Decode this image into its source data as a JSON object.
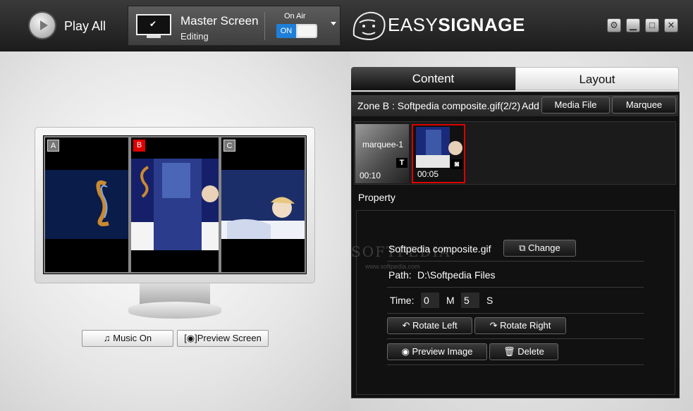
{
  "toolbar": {
    "play_all": "Play All",
    "screen_name": "Master Screen",
    "screen_status": "Editing",
    "on_air_label": "On Air",
    "on_air_toggle": "ON"
  },
  "logo": {
    "part1": "EASY",
    "part2": "SIGNAGE"
  },
  "window_controls": {
    "settings": "gear-icon",
    "minimize": "minimize-icon",
    "maximize": "maximize-icon",
    "close": "close-icon"
  },
  "preview": {
    "zones": [
      {
        "tag": "A",
        "color": "#777777"
      },
      {
        "tag": "B",
        "color": "#e00000"
      },
      {
        "tag": "C",
        "color": "#777777"
      }
    ],
    "music_button": "Music On",
    "preview_button": "Preview Screen"
  },
  "tabs": {
    "content": "Content",
    "layout": "Layout"
  },
  "zone_panel": {
    "title": "Zone B : Softpedia composite.gif(2/2)",
    "add_label": "Add",
    "media_file_button": "Media File",
    "marquee_button": "Marquee"
  },
  "media_items": [
    {
      "name": "marquee-1",
      "time": "00:10",
      "badge": "T",
      "selected": false
    },
    {
      "name": "",
      "time": "00:05",
      "badge": "camera-icon",
      "selected": true
    }
  ],
  "property": {
    "label": "Property",
    "filename": "Softpedia composite.gif",
    "change_button": "Change",
    "path_label": "Path:",
    "path_value": "D:\\Softpedia Files",
    "time_label": "Time:",
    "minutes": "0",
    "minutes_unit": "M",
    "seconds": "5",
    "seconds_unit": "S",
    "rotate_left": "Rotate Left",
    "rotate_right": "Rotate Right",
    "preview_image": "Preview Image",
    "delete": "Delete"
  },
  "watermark": {
    "text": "SOFTPEDIA",
    "url": "www.softpedia.com"
  }
}
